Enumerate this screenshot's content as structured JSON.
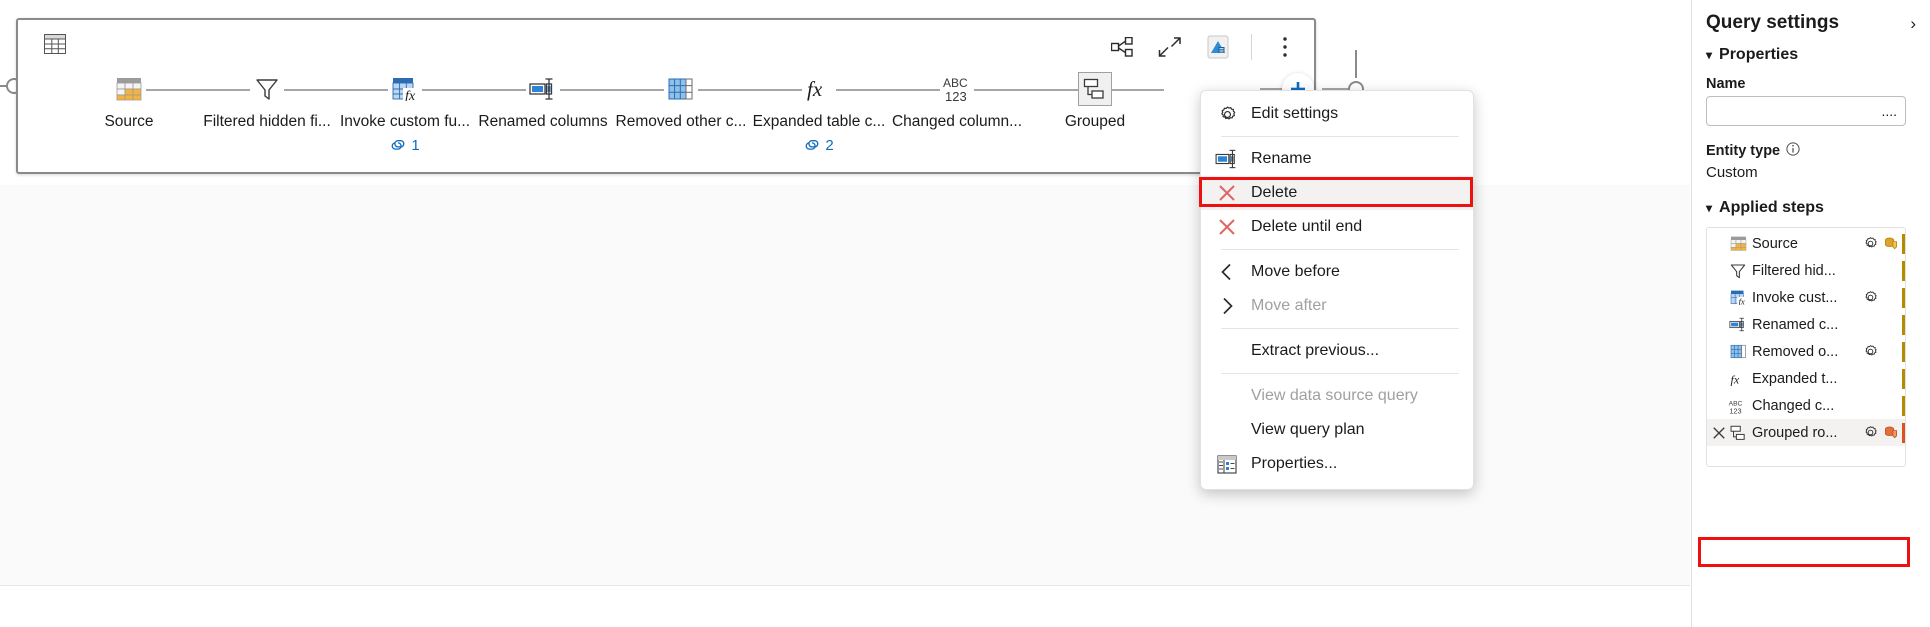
{
  "diagram": {
    "query_icon_name": "table-icon",
    "toolbar": [
      {
        "name": "share-hierarchy-icon",
        "label": "Share"
      },
      {
        "name": "collapse-arrows-icon",
        "label": "Collapse"
      },
      {
        "name": "data-source-app-icon",
        "label": "Data source"
      },
      {
        "name": "more-options-icon",
        "label": "More options"
      }
    ],
    "steps": [
      {
        "label": "Source",
        "icon": "source-table-icon",
        "badge": null,
        "selected": false
      },
      {
        "label": "Filtered hidden fi...",
        "icon": "filter-funnel-icon",
        "badge": null,
        "selected": false
      },
      {
        "label": "Invoke custom fu...",
        "icon": "invoke-function-icon",
        "badge": "1",
        "selected": false
      },
      {
        "label": "Renamed columns",
        "icon": "rename-column-icon",
        "badge": null,
        "selected": false
      },
      {
        "label": "Removed other c...",
        "icon": "blue-table-icon",
        "badge": null,
        "selected": false
      },
      {
        "label": "Expanded table c...",
        "icon": "fx-icon",
        "badge": "2",
        "selected": false
      },
      {
        "label": "Changed column...",
        "icon": "abc123-icon",
        "badge": null,
        "selected": false
      },
      {
        "label": "Grouped",
        "icon": "group-rows-icon",
        "badge": null,
        "selected": true
      }
    ],
    "add_step_label": "+"
  },
  "context_menu": {
    "items": [
      {
        "label": "Edit settings",
        "icon": "gear-icon",
        "disabled": false,
        "highlighted": false,
        "sep_after": true
      },
      {
        "label": "Rename",
        "icon": "rename-icon",
        "disabled": false,
        "highlighted": false,
        "sep_after": false
      },
      {
        "label": "Delete",
        "icon": "delete-x-icon",
        "disabled": false,
        "highlighted": true,
        "sep_after": false
      },
      {
        "label": "Delete until end",
        "icon": "delete-x-icon",
        "disabled": false,
        "highlighted": false,
        "sep_after": true
      },
      {
        "label": "Move before",
        "icon": "chevron-left-icon",
        "disabled": false,
        "highlighted": false,
        "sep_after": false
      },
      {
        "label": "Move after",
        "icon": "chevron-right-icon",
        "disabled": true,
        "highlighted": false,
        "sep_after": true
      },
      {
        "label": "Extract previous...",
        "icon": "none",
        "disabled": false,
        "highlighted": false,
        "sep_after": true
      },
      {
        "label": "View data source query",
        "icon": "none",
        "disabled": true,
        "highlighted": false,
        "sep_after": false
      },
      {
        "label": "View query plan",
        "icon": "none",
        "disabled": false,
        "highlighted": false,
        "sep_after": false
      },
      {
        "label": "Properties...",
        "icon": "properties-icon",
        "disabled": false,
        "highlighted": false,
        "sep_after": false
      }
    ],
    "highlight_color": "#ee1111"
  },
  "query_settings": {
    "title": "Query settings",
    "collapse_icon": "chevron-right-icon",
    "properties": {
      "section_label": "Properties",
      "name_label": "Name",
      "name_value": "....",
      "name_placeholder": "",
      "entity_type_label": "Entity type",
      "entity_type_info_icon": "info-icon",
      "entity_type_value": "Custom"
    },
    "applied_steps": {
      "section_label": "Applied steps",
      "rows": [
        {
          "label": "Source",
          "icon": "source-table-icon",
          "gear": true,
          "db": true,
          "delete": false,
          "selected": false
        },
        {
          "label": "Filtered hid...",
          "icon": "filter-funnel-icon",
          "gear": false,
          "db": false,
          "delete": false,
          "selected": false
        },
        {
          "label": "Invoke cust...",
          "icon": "invoke-function-icon",
          "gear": true,
          "db": false,
          "delete": false,
          "selected": false
        },
        {
          "label": "Renamed c...",
          "icon": "rename-column-icon",
          "gear": false,
          "db": false,
          "delete": false,
          "selected": false
        },
        {
          "label": "Removed o...",
          "icon": "blue-table-icon",
          "gear": true,
          "db": false,
          "delete": false,
          "selected": false
        },
        {
          "label": "Expanded t...",
          "icon": "fx-icon",
          "gear": false,
          "db": false,
          "delete": false,
          "selected": false
        },
        {
          "label": "Changed c...",
          "icon": "abc123-icon",
          "gear": false,
          "db": false,
          "delete": false,
          "selected": false
        },
        {
          "label": "Grouped ro...",
          "icon": "group-rows-icon",
          "gear": true,
          "db": true,
          "delete": true,
          "selected": true
        }
      ]
    }
  },
  "colors": {
    "accent_blue": "#0f6cbd",
    "highlight_red": "#ee1111",
    "source_orange": "#f2a93b",
    "step_bar_gold": "#b58b00",
    "db_orange": "#d9541e"
  }
}
